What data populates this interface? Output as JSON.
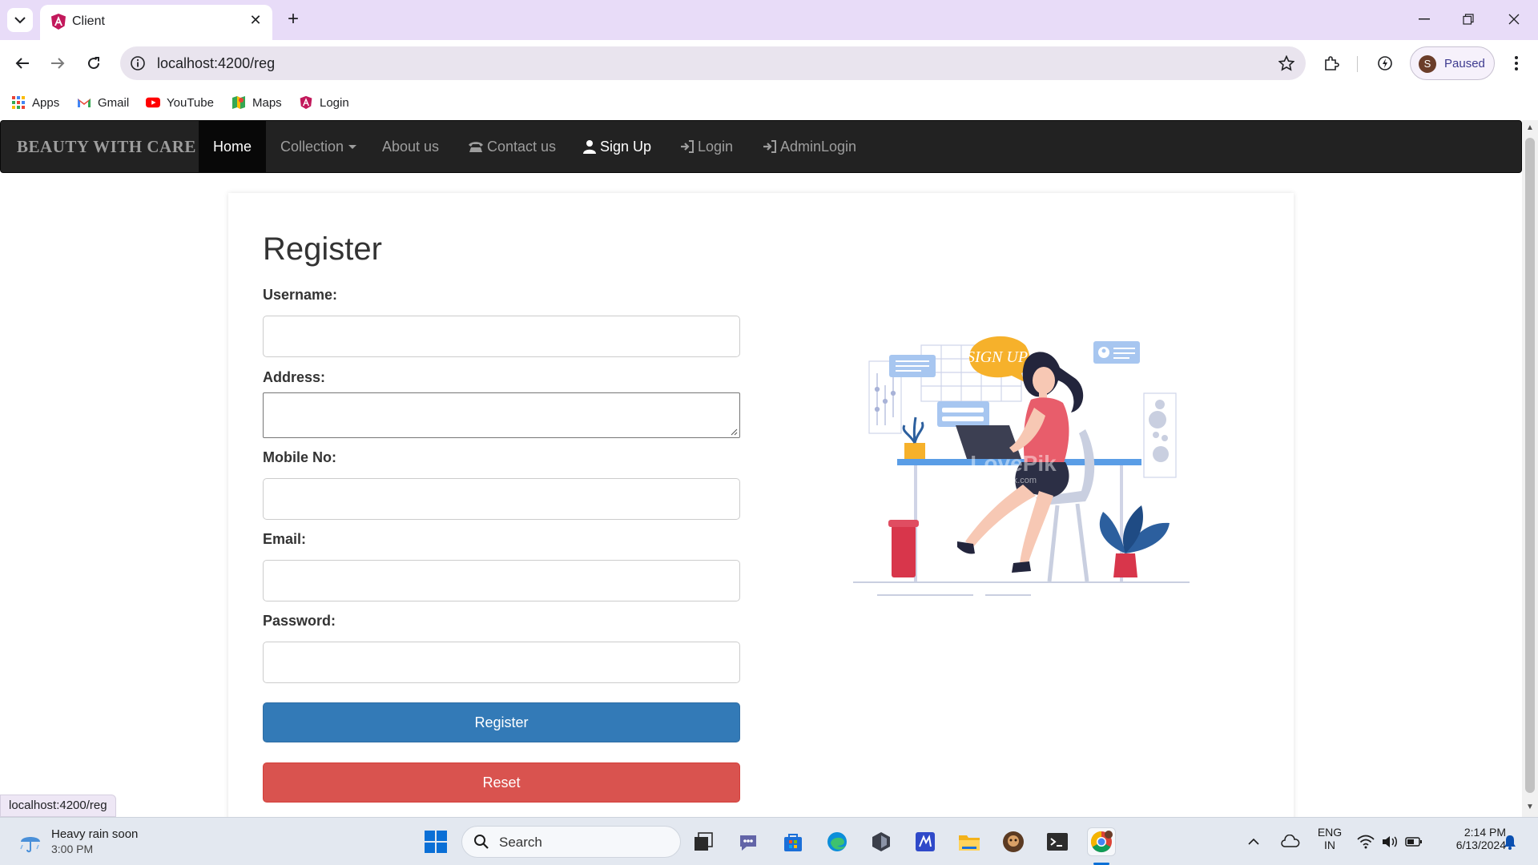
{
  "browser": {
    "tab_title": "Client",
    "url": "localhost:4200/reg",
    "profile_status": "Paused",
    "profile_initial": "S",
    "bookmarks": [
      "Apps",
      "Gmail",
      "YouTube",
      "Maps",
      "Login"
    ]
  },
  "navbar": {
    "brand": "BEAUTY WITH CARE",
    "items": [
      "Home",
      "Collection",
      "About us",
      "Contact us",
      "Sign Up",
      "Login",
      "AdminLogin"
    ]
  },
  "form": {
    "title": "Register",
    "username_label": "Username:",
    "address_label": "Address:",
    "mobile_label": "Mobile No:",
    "email_label": "Email:",
    "password_label": "Password:",
    "register_button": "Register",
    "reset_button": "Reset"
  },
  "illustration": {
    "bubble_text": "SIGN UP",
    "watermark": "LovePik",
    "watermark_sub": "lovepik.com"
  },
  "status_bar": {
    "hover_url": "localhost:4200/reg"
  },
  "taskbar": {
    "weather_line1": "Heavy rain soon",
    "weather_line2": "3:00 PM",
    "search_placeholder": "Search",
    "lang_line1": "ENG",
    "lang_line2": "IN",
    "time": "2:14 PM",
    "date": "6/13/2024"
  },
  "colors": {
    "navbar_bg": "#222222",
    "primary": "#337ab7",
    "danger": "#d9534f",
    "tabbar_bg": "#e8dcf8"
  }
}
